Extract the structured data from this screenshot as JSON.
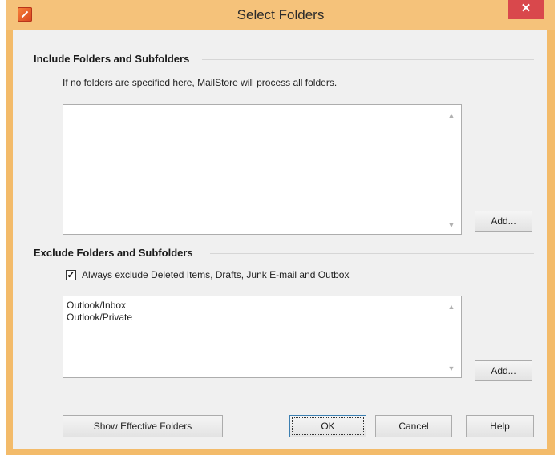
{
  "window": {
    "title": "Select Folders",
    "close_glyph": "✕",
    "app_icon": "mailstore-icon"
  },
  "include_group": {
    "title": "Include Folders and Subfolders",
    "note": "If no folders are specified here, MailStore will process all folders.",
    "items": [],
    "add_label": "Add..."
  },
  "exclude_group": {
    "title": "Exclude Folders and Subfolders",
    "checkbox_label": "Always exclude Deleted Items, Drafts, Junk E-mail and Outbox",
    "checkbox_checked": true,
    "items": [
      "Outlook/Inbox",
      "Outlook/Private"
    ],
    "add_label": "Add..."
  },
  "footer": {
    "show_effective_label": "Show Effective Folders",
    "ok_label": "OK",
    "cancel_label": "Cancel",
    "help_label": "Help"
  },
  "colors": {
    "frame": "#f5c27a",
    "close": "#d9484c",
    "client": "#f0f0f0"
  }
}
